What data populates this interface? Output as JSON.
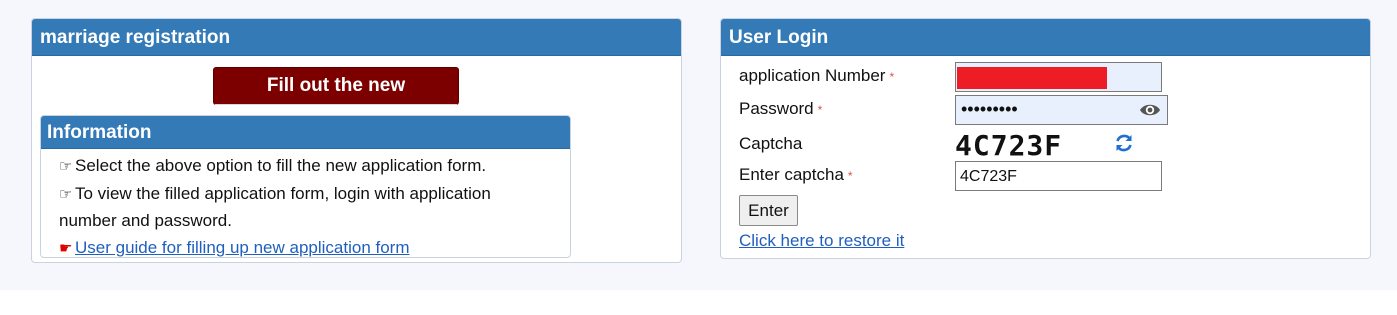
{
  "registration": {
    "title": "marriage registration",
    "fill_button": "Fill out the new",
    "info": {
      "title": "Information",
      "line1": "Select the above option to fill the new application form.",
      "line2": "To view the filled application form, login with application number and password.",
      "guide_link": "User guide for filling up new application form"
    }
  },
  "login": {
    "title": "User Login",
    "app_number_label": "application Number",
    "password_label": "Password",
    "password_value": "•••••••••",
    "captcha_label": "Captcha",
    "captcha_text": "4C723F",
    "enter_captcha_label": "Enter captcha",
    "enter_captcha_value": "4C723F",
    "required_mark": "*",
    "enter_button": "Enter",
    "restore_link": "Click here to restore it"
  },
  "icons": {
    "hand": "pointing-hand-icon",
    "eye": "eye-icon",
    "refresh": "refresh-icon"
  },
  "colors": {
    "header": "#337ab7",
    "fill_button": "#7d0000",
    "link": "#1f5fbf",
    "required": "#d9534f",
    "redacted": "#ee1c25"
  }
}
